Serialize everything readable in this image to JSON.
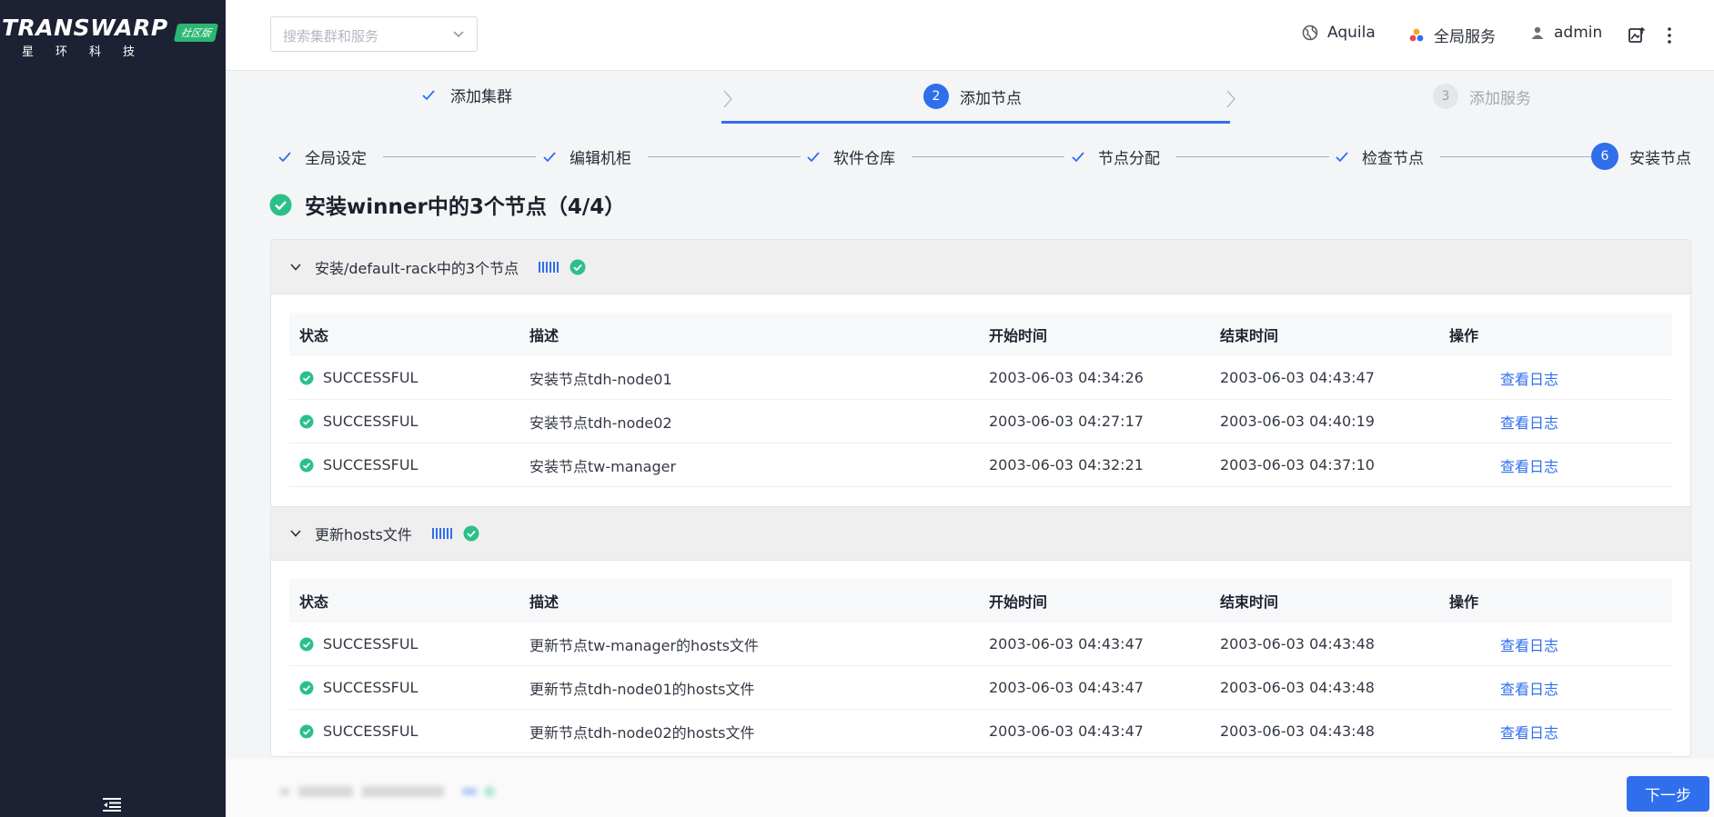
{
  "brand": {
    "word": "TRANSWARP",
    "badge": "社区版",
    "cn": "星环科技"
  },
  "header": {
    "search_placeholder": "搜索集群和服务",
    "aquila": "Aquila",
    "global_services": "全局服务",
    "user": "admin"
  },
  "steps": [
    {
      "label": "添加集群",
      "state": "done"
    },
    {
      "num": "2",
      "label": "添加节点",
      "state": "active"
    },
    {
      "num": "3",
      "label": "添加服务",
      "state": "pending"
    }
  ],
  "substeps": [
    {
      "label": "全局设定"
    },
    {
      "label": "编辑机柜"
    },
    {
      "label": "软件仓库"
    },
    {
      "label": "节点分配"
    },
    {
      "label": "检查节点"
    },
    {
      "num": "6",
      "label": "安装节点"
    }
  ],
  "main_title": "安装winner中的3个节点（4/4）",
  "columns": {
    "status": "状态",
    "desc": "描述",
    "start": "开始时间",
    "end": "结束时间",
    "op": "操作"
  },
  "groups": [
    {
      "title": "安装/default-rack中的3个节点",
      "rows": [
        {
          "status": "SUCCESSFUL",
          "desc": "安装节点tdh-node01",
          "start": "2003-06-03 04:34:26",
          "end": "2003-06-03 04:43:47",
          "op": "查看日志"
        },
        {
          "status": "SUCCESSFUL",
          "desc": "安装节点tdh-node02",
          "start": "2003-06-03 04:27:17",
          "end": "2003-06-03 04:40:19",
          "op": "查看日志"
        },
        {
          "status": "SUCCESSFUL",
          "desc": "安装节点tw-manager",
          "start": "2003-06-03 04:32:21",
          "end": "2003-06-03 04:37:10",
          "op": "查看日志"
        }
      ]
    },
    {
      "title": "更新hosts文件",
      "rows": [
        {
          "status": "SUCCESSFUL",
          "desc": "更新节点tw-manager的hosts文件",
          "start": "2003-06-03 04:43:47",
          "end": "2003-06-03 04:43:48",
          "op": "查看日志"
        },
        {
          "status": "SUCCESSFUL",
          "desc": "更新节点tdh-node01的hosts文件",
          "start": "2003-06-03 04:43:47",
          "end": "2003-06-03 04:43:48",
          "op": "查看日志"
        },
        {
          "status": "SUCCESSFUL",
          "desc": "更新节点tdh-node02的hosts文件",
          "start": "2003-06-03 04:43:47",
          "end": "2003-06-03 04:43:48",
          "op": "查看日志"
        }
      ]
    }
  ],
  "footer": {
    "next": "下一步"
  },
  "colors": {
    "primary": "#2f6fec",
    "success": "#2bc08a",
    "sidebar": "#1c2233"
  }
}
